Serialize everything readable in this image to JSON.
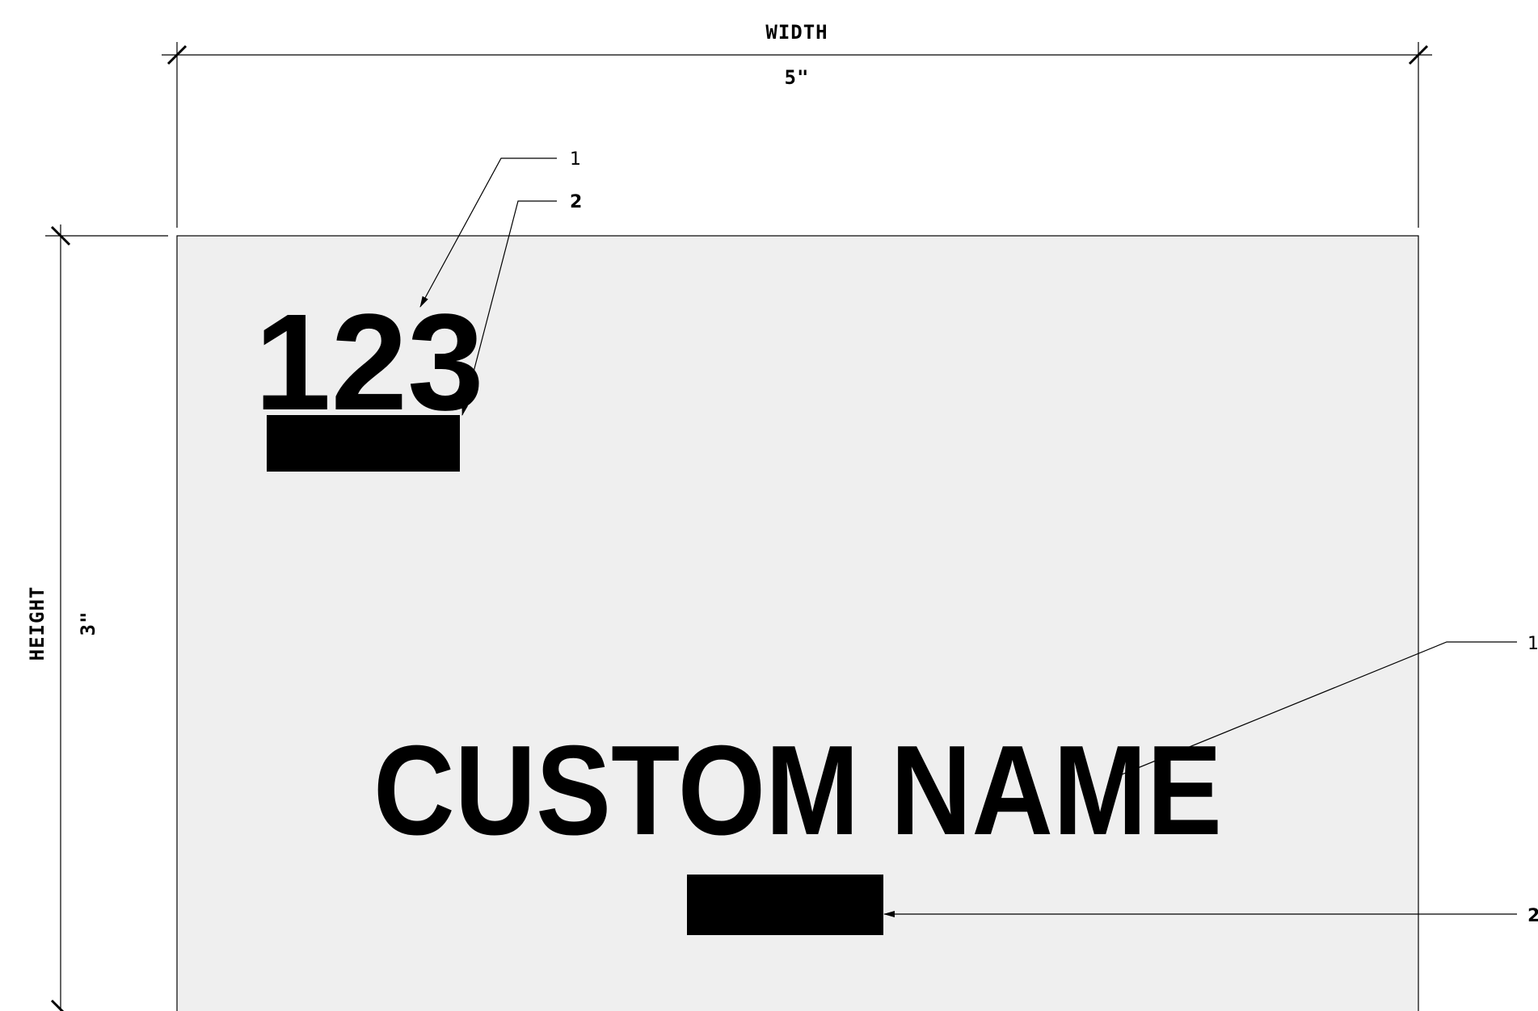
{
  "dimensions": {
    "width_label": "WIDTH",
    "width_value": "5\"",
    "height_label": "HEIGHT",
    "height_value": "3\""
  },
  "sign": {
    "background_color": "#efefef",
    "number_text": "123",
    "name_text": "CUSTOM NAME"
  },
  "callouts": {
    "top_1": "1",
    "top_2": "2",
    "right_1": "1",
    "right_2": "2"
  }
}
